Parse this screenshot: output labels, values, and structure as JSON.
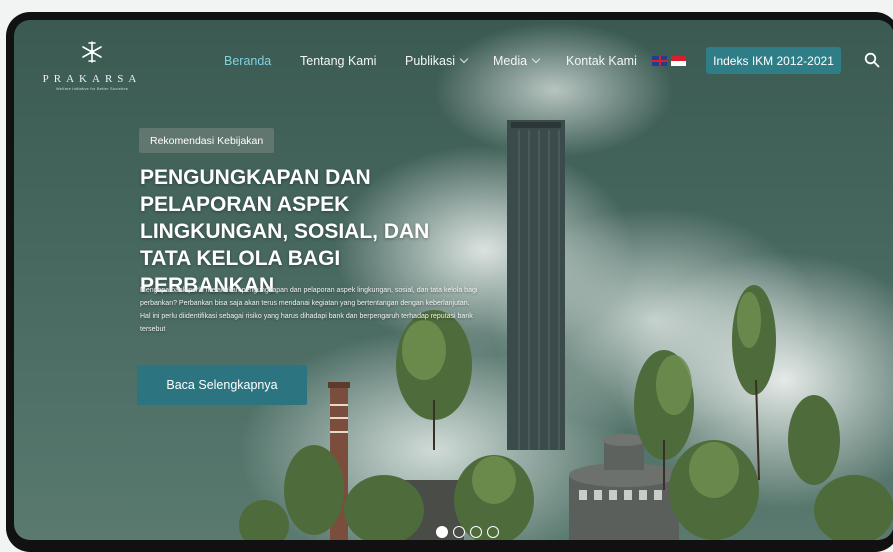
{
  "brand": {
    "name": "PRAKARSA",
    "tagline": "Welfare Initiative for Better Societies"
  },
  "nav": {
    "items": [
      {
        "label": "Beranda",
        "active": true,
        "dropdown": false
      },
      {
        "label": "Tentang Kami",
        "active": false,
        "dropdown": false
      },
      {
        "label": "Publikasi",
        "active": false,
        "dropdown": true
      },
      {
        "label": "Media",
        "active": false,
        "dropdown": true
      },
      {
        "label": "Kontak Kami",
        "active": false,
        "dropdown": false
      }
    ],
    "languages": [
      "en-flag-icon",
      "id-flag-icon"
    ],
    "cta_label": "Indeks IKM 2012-2021",
    "search_icon": "search-icon"
  },
  "hero": {
    "badge": "Rekomendasi Kebijakan",
    "title": "PENGUNGKAPAN DAN PELAPORAN ASPEK LINGKUNGAN, SOSIAL, DAN TATA KELOLA BAGI PERBANKAN",
    "description": "Mengapa bank perlu melakukan pengungkapan dan pelaporan aspek lingkungan, sosial, dan tata kelola bagi perbankan? Perbankan bisa saja akan terus mendanai kegiatan yang bertentangan dengan keberlanjutan. Hal ini perlu diidentifikasi sebagai risiko yang harus dihadapi bank dan berpengaruh terhadap reputasi bank tersebut",
    "button_label": "Baca Selengkapnya"
  },
  "slider": {
    "slides": 4,
    "active_index": 0
  },
  "colors": {
    "accent": "#2f7d86",
    "active_nav": "#7fd3df",
    "background": "#47685f"
  }
}
